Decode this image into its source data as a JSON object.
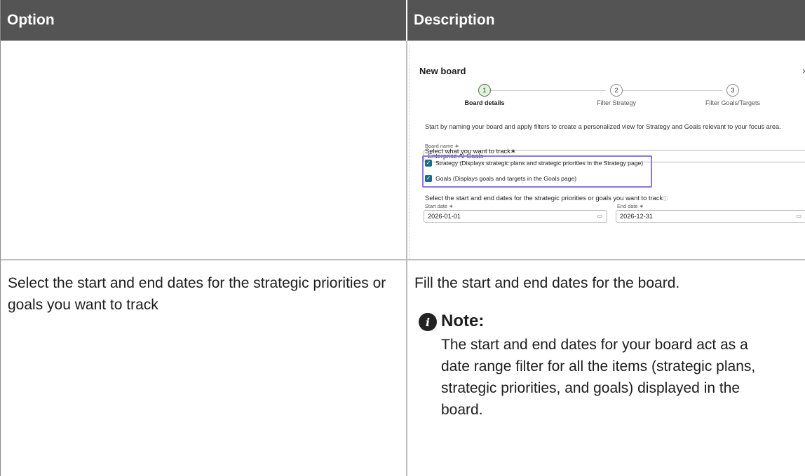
{
  "table": {
    "header": {
      "option": "Option",
      "description": "Description"
    },
    "row2": {
      "option": "Select the start and end dates for the strategic priorities or goals you want to track",
      "description": "Fill the start and end dates for the board.",
      "note": {
        "heading": "Note:",
        "body": "The start and end dates for your board act as a date range filter for all the items (strategic plans, strategic priorities, and goals) displayed in the board."
      }
    }
  },
  "screenshot": {
    "title": "New board",
    "close_icon": "×",
    "steps": [
      {
        "num": "1",
        "label": "Board details"
      },
      {
        "num": "2",
        "label": "Filter Strategy"
      },
      {
        "num": "3",
        "label": "Filter Goals/Targets"
      }
    ],
    "intro": "Start by naming your board and apply filters to create a personalized view for Strategy and Goals relevant to your focus area.",
    "board_name_label": "Board name ∗",
    "board_name_value": "Enterprise AI Goals",
    "track_label": "Select what you want to track∗",
    "track_options": [
      "Strategy (Displays strategic plans and strategic priorities in the Strategy page)",
      "Goals (Displays goals and targets in the Goals page)"
    ],
    "dates_label": "Select the start and end dates for the strategic priorities or goals you want to track",
    "dates_info_icon": "ⓘ",
    "start_label": "Start date ∗",
    "start_value": "2026-01-01",
    "end_label": "End date ∗",
    "end_value": "2026-12-31",
    "calendar_icon": "▭"
  },
  "colors": {
    "header_bg": "#545454",
    "checkbox": "#1a6d84",
    "highlight_box": "#8f75e6",
    "active_step": "#e3f1df"
  }
}
